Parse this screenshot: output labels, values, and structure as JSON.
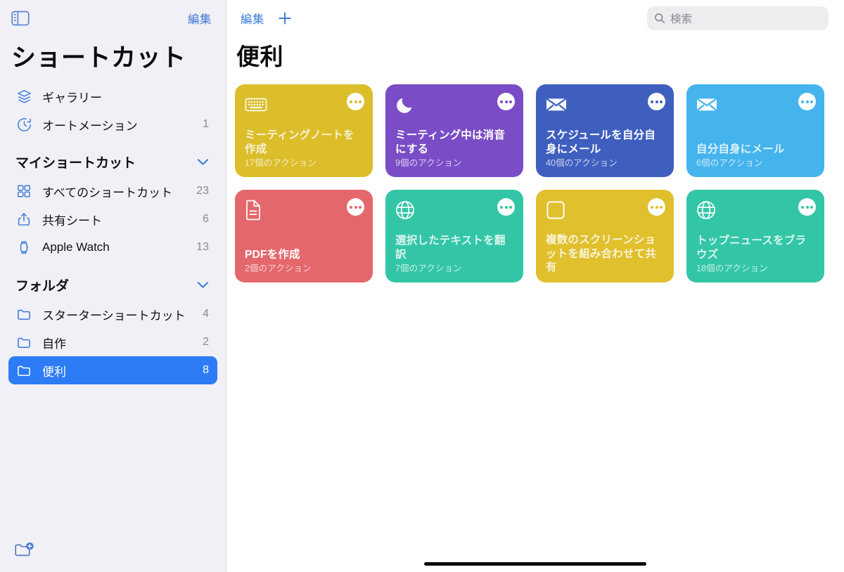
{
  "sidebar": {
    "toggle_icon": "sidebar-toggle-icon",
    "edit_label": "編集",
    "title": "ショートカット",
    "top_items": [
      {
        "icon": "gallery-layers-icon",
        "label": "ギャラリー",
        "count": ""
      },
      {
        "icon": "automation-clock-icon",
        "label": "オートメーション",
        "count": "1"
      }
    ],
    "sections": [
      {
        "title": "マイショートカット",
        "chevron": "chevron-down-icon",
        "items": [
          {
            "icon": "grid-squares-icon",
            "label": "すべてのショートカット",
            "count": "23"
          },
          {
            "icon": "share-sheet-icon",
            "label": "共有シート",
            "count": "6"
          },
          {
            "icon": "apple-watch-icon",
            "label": "Apple Watch",
            "count": "13"
          }
        ]
      },
      {
        "title": "フォルダ",
        "chevron": "chevron-down-icon",
        "items": [
          {
            "icon": "folder-icon",
            "label": "スターターショートカット",
            "count": "4",
            "selected": false
          },
          {
            "icon": "folder-icon",
            "label": "自作",
            "count": "2",
            "selected": false
          },
          {
            "icon": "folder-icon",
            "label": "便利",
            "count": "8",
            "selected": true
          }
        ]
      }
    ],
    "footer_icon": "new-folder-icon",
    "accent_color": "#3B7BD6",
    "selected_color": "#2D7CF6"
  },
  "main": {
    "edit_label": "編集",
    "add_icon": "plus-icon",
    "search": {
      "icon": "search-icon",
      "placeholder": "検索",
      "value": ""
    },
    "title": "便利",
    "cards": [
      {
        "icon": "keyboard-icon",
        "name": "ミーティングノートを作成",
        "count": "17個のアクション",
        "color": "#DCBE2B",
        "dim": true,
        "menu_icon": "more-dots-icon",
        "dot_color": "#DCBE2B"
      },
      {
        "icon": "moon-icon",
        "name": "ミーティング中は消音にする",
        "count": "9個のアクション",
        "color": "#7A4DC6",
        "dim": false,
        "menu_icon": "more-dots-icon",
        "dot_color": "#7A4DC6"
      },
      {
        "icon": "envelope-icon",
        "name": "スケジュールを自分自身にメール",
        "count": "40個のアクション",
        "color": "#3F5FBF",
        "dim": false,
        "menu_icon": "more-dots-icon",
        "dot_color": "#3F5FBF"
      },
      {
        "icon": "envelope-icon",
        "name": "自分自身にメール",
        "count": "6個のアクション",
        "color": "#45B4EC",
        "dim": true,
        "menu_icon": "more-dots-icon",
        "dot_color": "#45B4EC"
      },
      {
        "icon": "document-icon",
        "name": "PDFを作成",
        "count": "2個のアクション",
        "color": "#E4676C",
        "dim": false,
        "menu_icon": "more-dots-icon",
        "dot_color": "#E4676C"
      },
      {
        "icon": "globe-icon",
        "name": "選択したテキストを翻訳",
        "count": "7個のアクション",
        "color": "#33C6A6",
        "dim": true,
        "menu_icon": "more-dots-icon",
        "dot_color": "#33C6A6"
      },
      {
        "icon": "square-icon",
        "name": "複数のスクリーンショットを組み合わせて共有",
        "count": "",
        "color": "#E0C02C",
        "dim": true,
        "menu_icon": "more-dots-icon",
        "dot_color": "#E0C02C"
      },
      {
        "icon": "globe-icon",
        "name": "トップニュースをブラウズ",
        "count": "18個のアクション",
        "color": "#33C6A6",
        "dim": true,
        "menu_icon": "more-dots-icon",
        "dot_color": "#33C6A6"
      }
    ]
  },
  "home_indicator": "home-indicator"
}
